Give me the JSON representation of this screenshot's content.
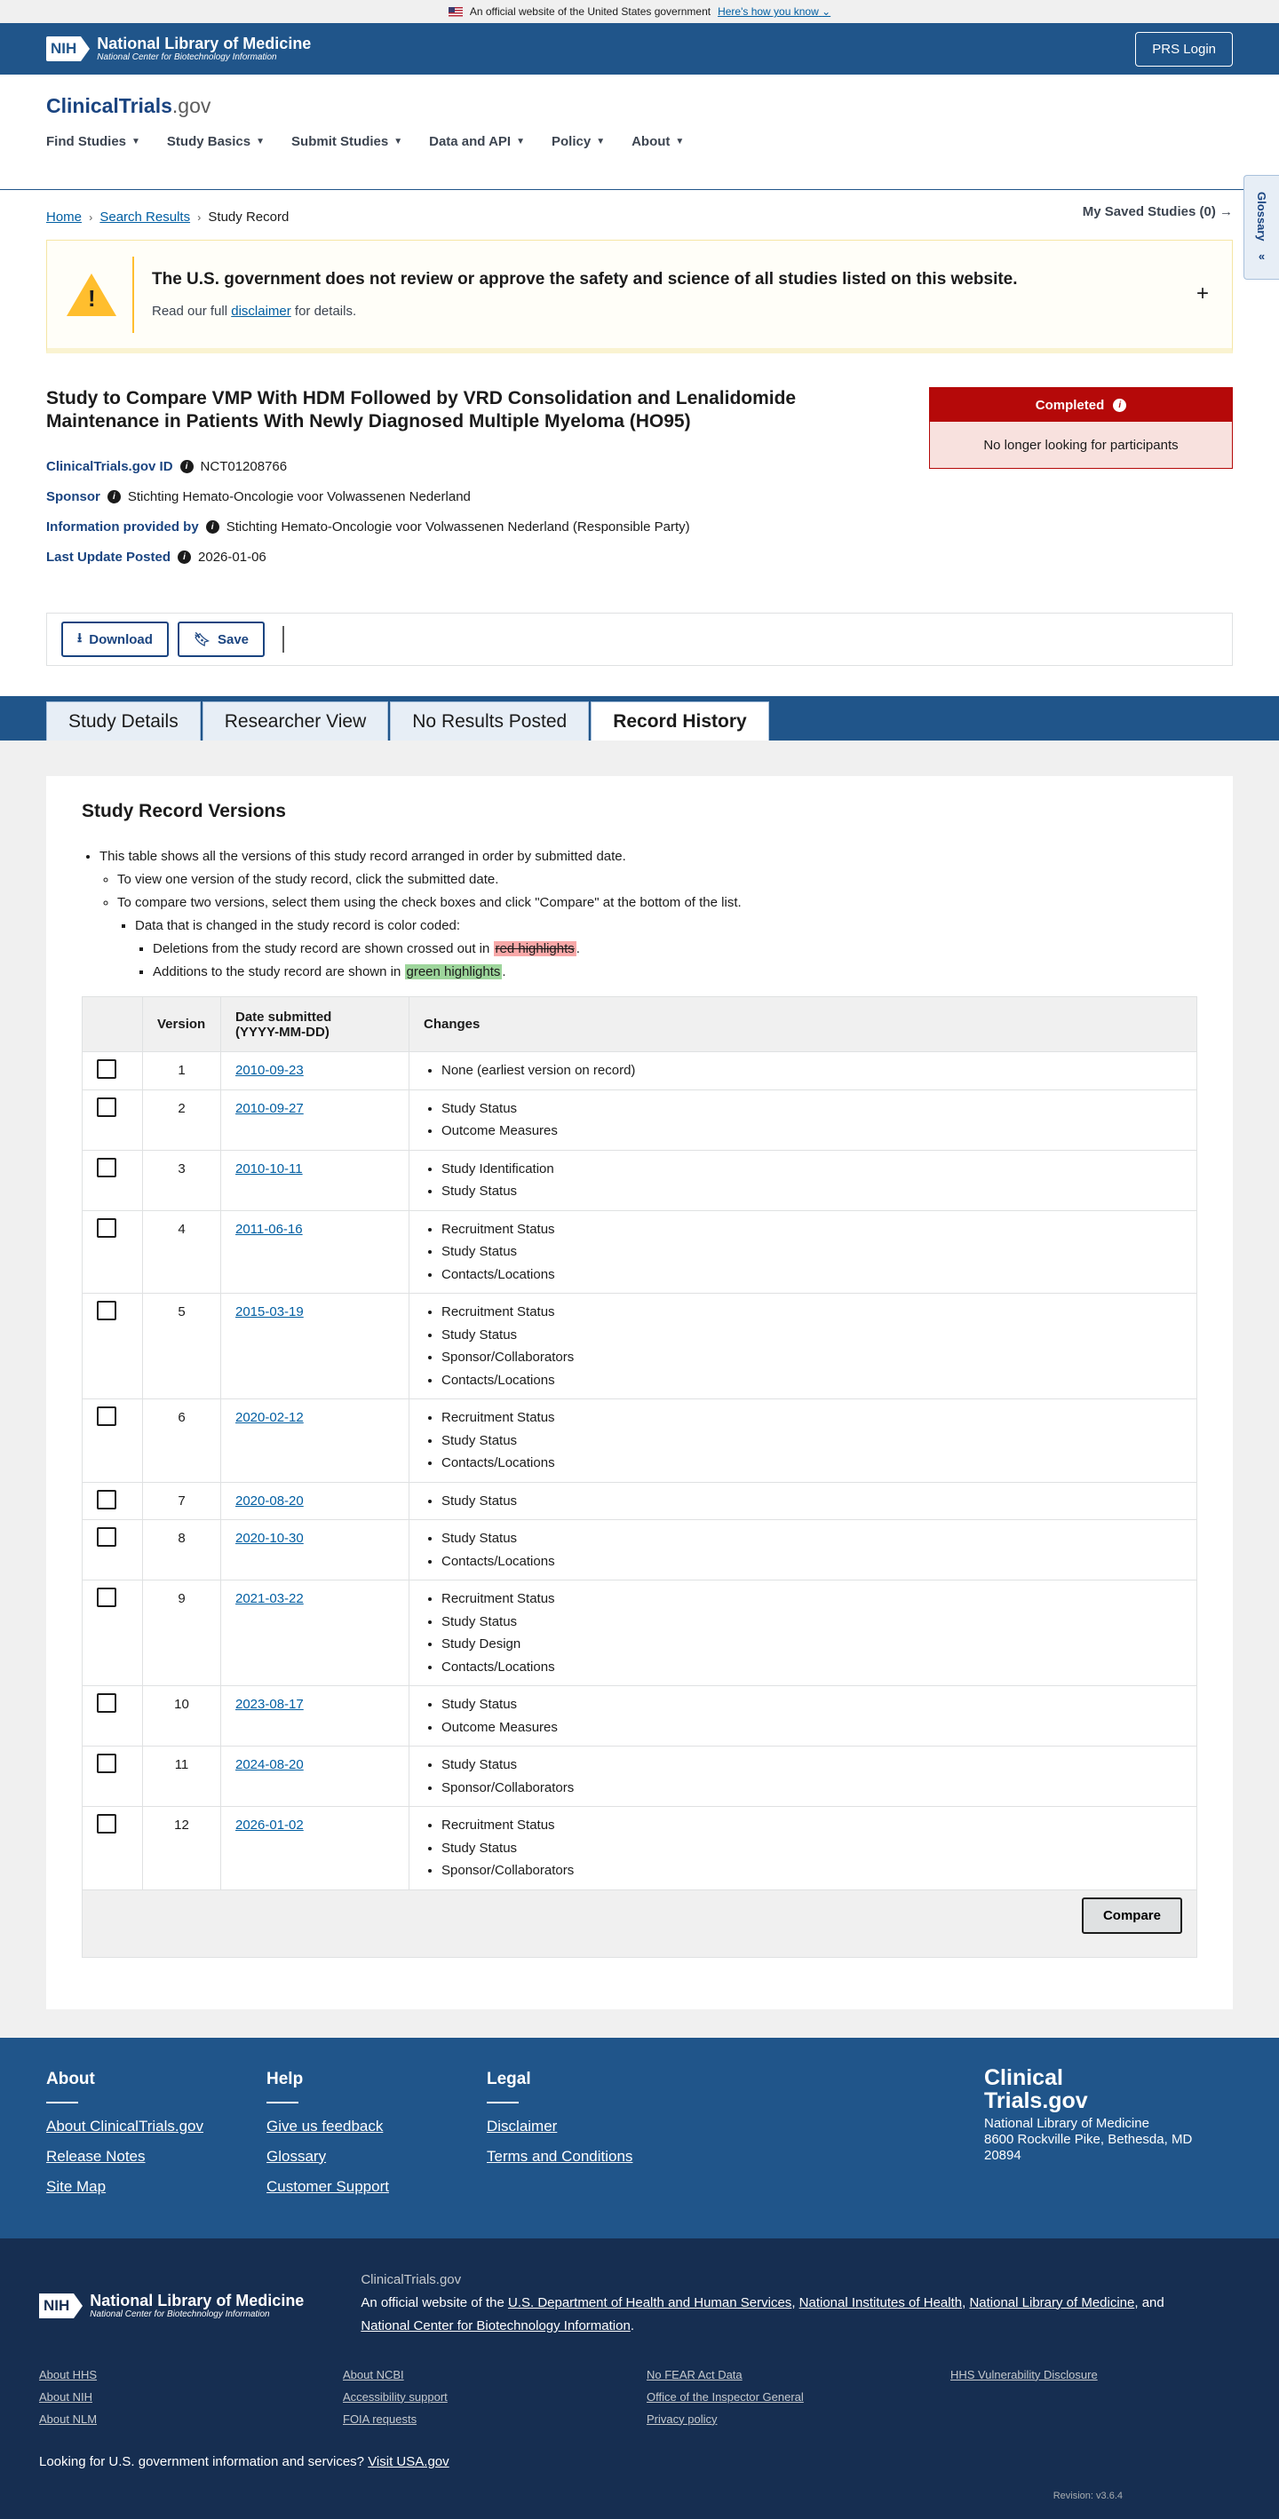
{
  "gov_banner": {
    "text": "An official website of the United States government",
    "link": "Here's how you know"
  },
  "nih_header": {
    "badge": "NIH",
    "title": "National Library of Medicine",
    "subtitle": "National Center for Biotechnology Information",
    "prs_login": "PRS Login"
  },
  "site": {
    "title_main": "ClinicalTrials",
    "title_gov": ".gov"
  },
  "nav": {
    "items": [
      "Find Studies",
      "Study Basics",
      "Submit Studies",
      "Data and API",
      "Policy",
      "About"
    ],
    "saved": "My Saved Studies (0)"
  },
  "glossary_tab": "Glossary",
  "breadcrumb": {
    "home": "Home",
    "search": "Search Results",
    "current": "Study Record"
  },
  "disclaimer": {
    "title": "The U.S. government does not review or approve the safety and science of all studies listed on this website.",
    "sub_before": "Read our full",
    "sub_link": "disclaimer",
    "sub_after": "for details."
  },
  "study": {
    "title": "Study to Compare VMP With HDM Followed by VRD Consolidation and Lenalidomide Maintenance in Patients With Newly Diagnosed Multiple Myeloma (HO95)",
    "id_label": "ClinicalTrials.gov ID",
    "id_value": "NCT01208766",
    "sponsor_label": "Sponsor",
    "sponsor_value": "Stichting Hemato-Oncologie voor Volwassenen Nederland",
    "provided_label": "Information provided by",
    "provided_value": "Stichting Hemato-Oncologie voor Volwassenen Nederland (Responsible Party)",
    "updated_label": "Last Update Posted",
    "updated_value": "2026-01-06",
    "status": "Completed",
    "status_sub": "No longer looking for participants"
  },
  "actions": {
    "download": "Download",
    "save": "Save"
  },
  "tabs": [
    "Study Details",
    "Researcher View",
    "No Results Posted",
    "Record History"
  ],
  "versions": {
    "heading": "Study Record Versions",
    "note1": "This table shows all the versions of this study record arranged in order by submitted date.",
    "note2": "To view one version of the study record, click the submitted date.",
    "note3": "To compare two versions, select them using the check boxes and click \"Compare\" at the bottom of the list.",
    "note4": "Data that is changed in the study record is color coded:",
    "note5_before": "Deletions from the study record are shown crossed out in",
    "note5_hl": "red highlights",
    "note6_before": "Additions to the study record are shown in",
    "note6_hl": "green highlights",
    "col_version": "Version",
    "col_date_1": "Date submitted",
    "col_date_2": "(YYYY-MM-DD)",
    "col_changes": "Changes",
    "compare": "Compare",
    "rows": [
      {
        "v": "1",
        "date": "2010-09-23",
        "changes": [
          "None (earliest version on record)"
        ]
      },
      {
        "v": "2",
        "date": "2010-09-27",
        "changes": [
          "Study Status",
          "Outcome Measures"
        ]
      },
      {
        "v": "3",
        "date": "2010-10-11",
        "changes": [
          "Study Identification",
          "Study Status"
        ]
      },
      {
        "v": "4",
        "date": "2011-06-16",
        "changes": [
          "Recruitment Status",
          "Study Status",
          "Contacts/Locations"
        ]
      },
      {
        "v": "5",
        "date": "2015-03-19",
        "changes": [
          "Recruitment Status",
          "Study Status",
          "Sponsor/Collaborators",
          "Contacts/Locations"
        ]
      },
      {
        "v": "6",
        "date": "2020-02-12",
        "changes": [
          "Recruitment Status",
          "Study Status",
          "Contacts/Locations"
        ]
      },
      {
        "v": "7",
        "date": "2020-08-20",
        "changes": [
          "Study Status"
        ]
      },
      {
        "v": "8",
        "date": "2020-10-30",
        "changes": [
          "Study Status",
          "Contacts/Locations"
        ]
      },
      {
        "v": "9",
        "date": "2021-03-22",
        "changes": [
          "Recruitment Status",
          "Study Status",
          "Study Design",
          "Contacts/Locations"
        ]
      },
      {
        "v": "10",
        "date": "2023-08-17",
        "changes": [
          "Study Status",
          "Outcome Measures"
        ]
      },
      {
        "v": "11",
        "date": "2024-08-20",
        "changes": [
          "Study Status",
          "Sponsor/Collaborators"
        ]
      },
      {
        "v": "12",
        "date": "2026-01-02",
        "changes": [
          "Recruitment Status",
          "Study Status",
          "Sponsor/Collaborators"
        ]
      }
    ]
  },
  "footer": {
    "about_h": "About",
    "about_links": [
      "About ClinicalTrials.gov",
      "Release Notes",
      "Site Map"
    ],
    "help_h": "Help",
    "help_links": [
      "Give us feedback",
      "Glossary",
      "Customer Support"
    ],
    "legal_h": "Legal",
    "legal_links": [
      "Disclaimer",
      "Terms and Conditions"
    ],
    "logo_line1": "Clinical",
    "logo_line2": "Trials.gov",
    "addr1": "National Library of Medicine",
    "addr2": "8600 Rockville Pike, Bethesda, MD",
    "addr3": "20894"
  },
  "footer_bottom": {
    "ct": "ClinicalTrials.gov",
    "official": "An official website of the",
    "hhs": "U.S. Department of Health and Human Services",
    "nih": "National Institutes of Health",
    "nlm": "National Library of Medicine",
    "and": "and",
    "ncbi": "National Center for Biotechnology Information",
    "links": [
      "About HHS",
      "About NCBI",
      "No FEAR Act Data",
      "HHS Vulnerability Disclosure",
      "About NIH",
      "Accessibility support",
      "Office of the Inspector General",
      "",
      "About NLM",
      "FOIA requests",
      "Privacy policy",
      ""
    ],
    "usa_text": "Looking for U.S. government information and services?",
    "usa_link": "Visit USA.gov",
    "revision": "Revision: v3.6.4"
  }
}
